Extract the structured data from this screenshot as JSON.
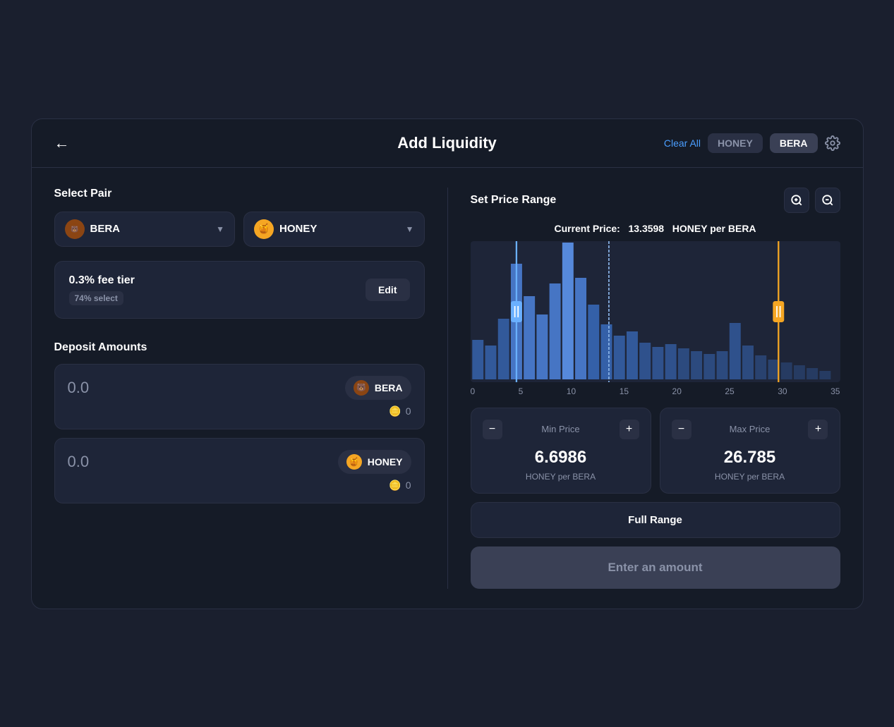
{
  "header": {
    "title": "Add Liquidity",
    "back_label": "←",
    "clear_all_label": "Clear All",
    "token_tab_1": "HONEY",
    "token_tab_2": "BERA",
    "settings_icon": "⚙"
  },
  "select_pair": {
    "label": "Select Pair",
    "token1": "BERA",
    "token2": "HONEY"
  },
  "fee_tier": {
    "label": "0.3% fee tier",
    "badge": "74% select",
    "edit_label": "Edit"
  },
  "deposit": {
    "label": "Deposit Amounts",
    "amount1": "0.0",
    "token1": "BERA",
    "balance1": "0",
    "amount2": "0.0",
    "token2": "HONEY",
    "balance2": "0"
  },
  "price_range": {
    "label": "Set Price Range",
    "current_price_label": "Current Price:",
    "current_price_value": "13.3598",
    "current_price_unit": "HONEY per BERA",
    "zoom_in_icon": "⊕",
    "zoom_out_icon": "⊖",
    "x_labels": [
      "0",
      "5",
      "10",
      "15",
      "20",
      "25",
      "30",
      "35"
    ],
    "min_price": {
      "label": "Min Price",
      "value": "6.6986",
      "unit": "HONEY per BERA",
      "minus": "−",
      "plus": "+"
    },
    "max_price": {
      "label": "Max Price",
      "value": "26.785",
      "unit": "HONEY per BERA",
      "minus": "−",
      "plus": "+"
    },
    "full_range_label": "Full Range",
    "enter_amount_label": "Enter an amount"
  },
  "chart": {
    "bars": [
      {
        "x": 0,
        "height": 0.2
      },
      {
        "x": 1,
        "height": 0.15
      },
      {
        "x": 2,
        "height": 0.45
      },
      {
        "x": 3,
        "height": 0.85
      },
      {
        "x": 4,
        "height": 0.6
      },
      {
        "x": 5,
        "height": 0.4
      },
      {
        "x": 6,
        "height": 0.7
      },
      {
        "x": 7,
        "height": 1.0
      },
      {
        "x": 8,
        "height": 0.75
      },
      {
        "x": 9,
        "height": 0.55
      },
      {
        "x": 10,
        "height": 0.35
      },
      {
        "x": 11,
        "height": 0.25
      },
      {
        "x": 12,
        "height": 0.3
      },
      {
        "x": 13,
        "height": 0.2
      },
      {
        "x": 14,
        "height": 0.15
      },
      {
        "x": 15,
        "height": 0.18
      },
      {
        "x": 16,
        "height": 0.12
      },
      {
        "x": 17,
        "height": 0.1
      },
      {
        "x": 18,
        "height": 0.08
      },
      {
        "x": 19,
        "height": 0.1
      },
      {
        "x": 20,
        "height": 0.35
      },
      {
        "x": 21,
        "height": 0.15
      },
      {
        "x": 22,
        "height": 0.08
      },
      {
        "x": 23,
        "height": 0.06
      },
      {
        "x": 24,
        "height": 0.05
      },
      {
        "x": 25,
        "height": 0.04
      },
      {
        "x": 26,
        "height": 0.03
      },
      {
        "x": 27,
        "height": 0.02
      }
    ],
    "colors": {
      "bar": "#3a6fc4",
      "bar_dark": "#2a5090",
      "left_handle": "#6ab0ff",
      "right_handle": "#f5a623",
      "range_fill": "#3a6fc4"
    }
  }
}
